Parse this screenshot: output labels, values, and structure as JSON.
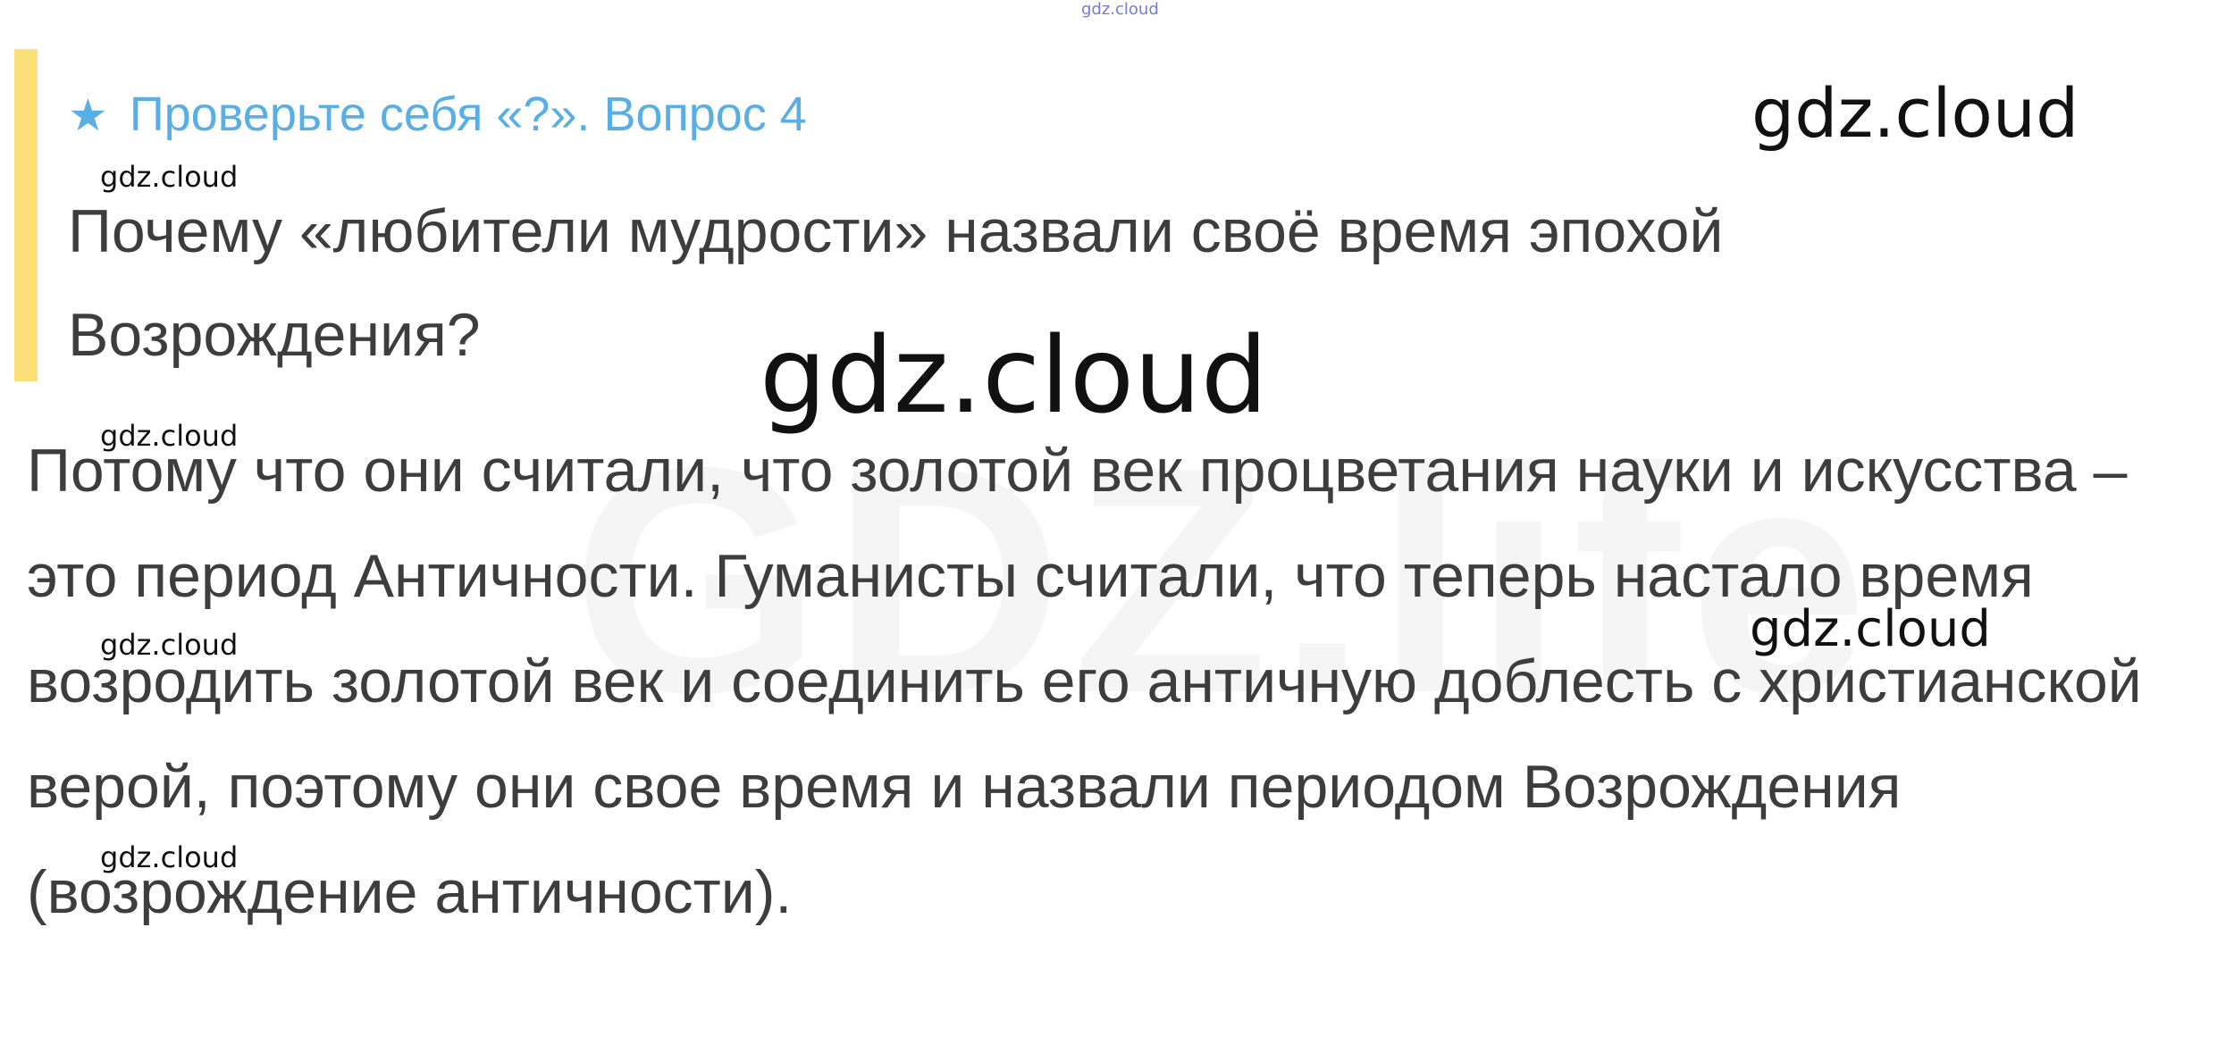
{
  "question": {
    "star_icon": "★",
    "header": "Проверьте себя «?». Вопрос 4",
    "text": "Почему «любители мудрости» назвали своё время эпохой Возрождения?"
  },
  "answer": {
    "text": "Потому что они считали, что золотой век процветания науки и искусства – это период Античности. Гуманисты считали, что теперь настало время возродить золотой век и соединить его античную доблесть с христианской верой, поэтому они свое время и назвали периодом Возрождения (возрождение античности)."
  },
  "watermarks": {
    "top": "gdz.cloud",
    "large_right": "gdz.cloud",
    "huge": "gdz.cloud",
    "medium_right": "gdz.cloud",
    "small_1": "gdz.cloud",
    "small_2": "gdz.cloud",
    "small_3": "gdz.cloud",
    "small_4": "gdz.cloud"
  },
  "colors": {
    "accent_bar": "#fbe07a",
    "header_blue": "#5aaee6",
    "body_text": "#3d3d3d"
  }
}
